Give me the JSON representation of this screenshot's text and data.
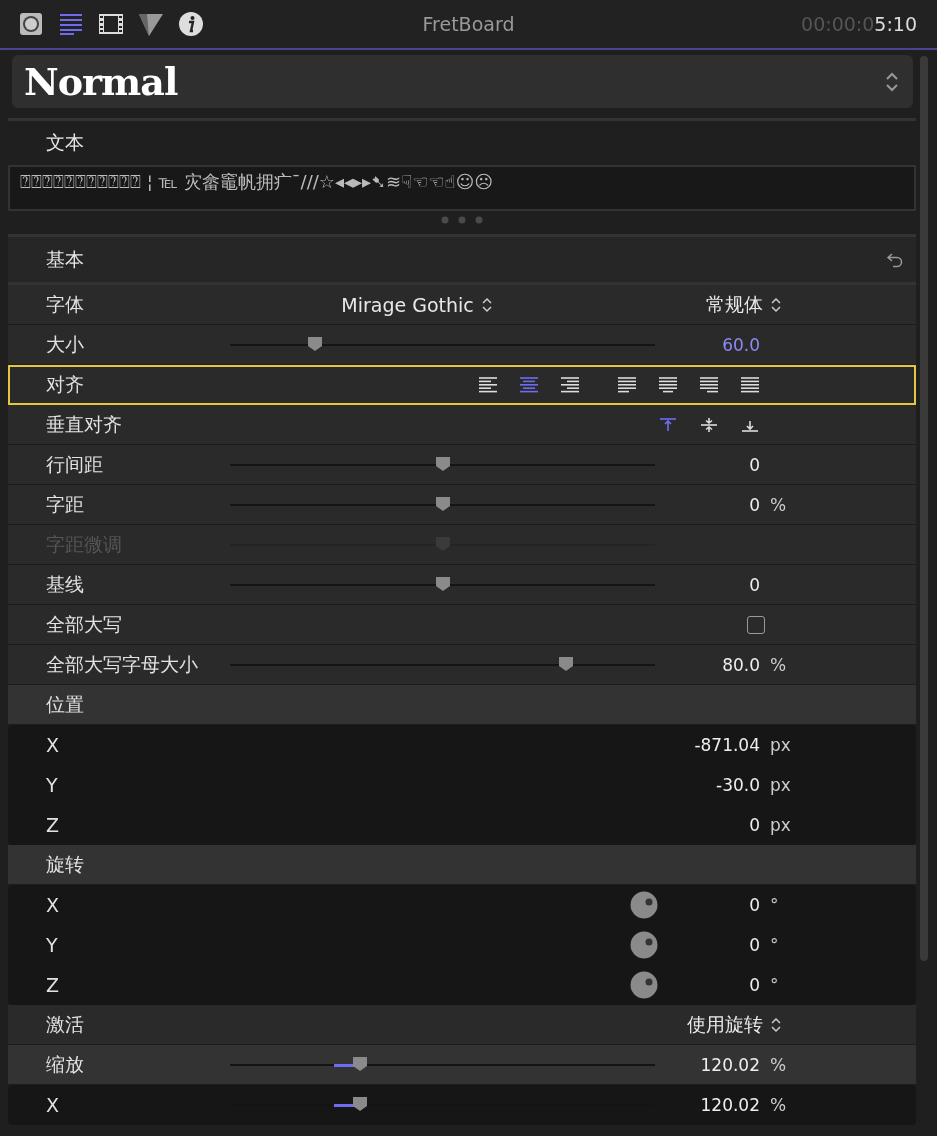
{
  "toolbar": {
    "tabs": [
      {
        "kind": "badge",
        "selected": false
      },
      {
        "kind": "text",
        "selected": true
      },
      {
        "kind": "film",
        "selected": false
      },
      {
        "kind": "shape",
        "selected": false
      },
      {
        "kind": "info",
        "selected": false
      }
    ],
    "title": "FretBoard",
    "timecode_dim": "00:00:0",
    "timecode": "5:10"
  },
  "preset": {
    "value": "Normal"
  },
  "text_section": {
    "title": "文本",
    "value": "⍰⍰⍰⍰⍰⍰⍰⍰⍰⍰⍰ ¦ ℡ 灾畲竈帆拥疒¯///☆◂◂▸▸➷≋☟☜☜☝☺☹"
  },
  "basic_section": {
    "title": "基本"
  },
  "rows": [
    {
      "kind": "popup",
      "label": "字体",
      "value": "Mirage Gothic",
      "value2": "常规体"
    },
    {
      "kind": "slider",
      "label": "大小",
      "level": 0.2,
      "value": "60.0",
      "modified": true
    },
    {
      "kind": "align",
      "label": "对齐",
      "focused": true,
      "options": [
        {
          "selected": false
        },
        {
          "selected": true
        },
        {
          "selected": false
        },
        {
          "selected": false
        },
        {
          "selected": false
        },
        {
          "selected": false
        },
        {
          "selected": false
        }
      ]
    },
    {
      "kind": "valign",
      "label": "垂直对齐",
      "options": [
        {
          "selected": true
        },
        {
          "selected": false
        },
        {
          "selected": false
        }
      ]
    },
    {
      "kind": "slider",
      "label": "行间距",
      "level": 0.5,
      "value": "0"
    },
    {
      "kind": "slider",
      "label": "字距",
      "level": 0.5,
      "value": "0",
      "unit": "%"
    },
    {
      "kind": "slider",
      "label": "字距微调",
      "level": 0.5,
      "disabled": true
    },
    {
      "kind": "slider",
      "label": "基线",
      "level": 0.5,
      "value": "0"
    },
    {
      "kind": "checkbox",
      "label": "全部大写",
      "checked": false
    },
    {
      "kind": "slider",
      "label": "全部大写字母大小",
      "level": 0.79,
      "value": "80.0",
      "unit": "%"
    },
    {
      "kind": "group",
      "label": "位置",
      "children": [
        {
          "kind": "value",
          "label": "X",
          "value": "-871.04",
          "unit": "px"
        },
        {
          "kind": "value",
          "label": "Y",
          "value": "-30.0",
          "unit": "px"
        },
        {
          "kind": "value",
          "label": "Z",
          "value": "0",
          "unit": "px"
        }
      ]
    },
    {
      "kind": "group",
      "label": "旋转",
      "children": [
        {
          "kind": "dial",
          "label": "X",
          "value": "0",
          "unit": "°"
        },
        {
          "kind": "dial",
          "label": "Y",
          "value": "0",
          "unit": "°"
        },
        {
          "kind": "dial",
          "label": "Z",
          "value": "0",
          "unit": "°"
        }
      ]
    },
    {
      "kind": "popup",
      "label": "激活",
      "value2": "使用旋转"
    },
    {
      "kind": "slider",
      "label": "缩放",
      "level": 0.305,
      "value": "120.02",
      "unit": "%",
      "over_default": true,
      "children": [
        {
          "kind": "slider",
          "label": "X",
          "level": 0.305,
          "value": "120.02",
          "unit": "%",
          "over_default": true
        }
      ]
    }
  ]
}
